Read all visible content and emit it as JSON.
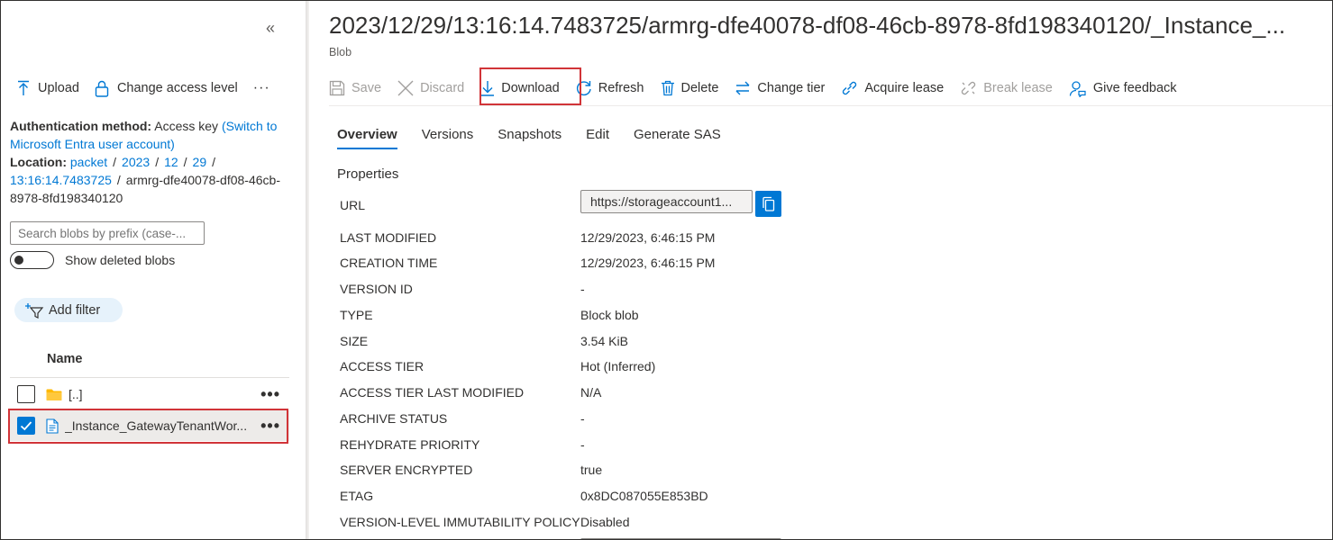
{
  "left_pane": {
    "collapse_glyph": "«",
    "toolbar": {
      "upload_label": "Upload",
      "change_access_label": "Change access level",
      "more_glyph": "···"
    },
    "auth": {
      "method_label": "Authentication method:",
      "method_value": "Access key",
      "switch_link": "(Switch to Microsoft Entra user account)",
      "location_label": "Location:",
      "path_links": [
        "packet",
        "2023",
        "12",
        "29",
        "13:16:14.7483725"
      ],
      "path_tail": "armrg-dfe40078-df08-46cb-8978-8fd198340120"
    },
    "search_placeholder": "Search blobs by prefix (case-...",
    "show_deleted_label": "Show deleted blobs",
    "show_deleted_on": false,
    "add_filter_label": "Add filter",
    "list": {
      "header": "Name",
      "rows": [
        {
          "name": "[..]",
          "checked": false,
          "icon": "folder-icon"
        },
        {
          "name": "_Instance_GatewayTenantWor...",
          "checked": true,
          "icon": "file-icon"
        }
      ]
    }
  },
  "blob": {
    "title": "2023/12/29/13:16:14.7483725/armrg-dfe40078-df08-46cb-8978-8fd198340120/_Instance_...",
    "subtitle": "Blob",
    "toolbar": {
      "save": "Save",
      "discard": "Discard",
      "download": "Download",
      "refresh": "Refresh",
      "delete": "Delete",
      "change_tier": "Change tier",
      "acquire_lease": "Acquire lease",
      "break_lease": "Break lease",
      "give_feedback": "Give feedback"
    },
    "tabs": [
      "Overview",
      "Versions",
      "Snapshots",
      "Edit",
      "Generate SAS"
    ],
    "active_tab": "Overview",
    "properties_title": "Properties",
    "url_label": "URL",
    "url_value": "https://storageaccount1...",
    "properties": [
      {
        "label": "LAST MODIFIED",
        "value": "12/29/2023, 6:46:15 PM"
      },
      {
        "label": "CREATION TIME",
        "value": "12/29/2023, 6:46:15 PM"
      },
      {
        "label": "VERSION ID",
        "value": "-"
      },
      {
        "label": "TYPE",
        "value": "Block blob"
      },
      {
        "label": "SIZE",
        "value": "3.54 KiB"
      },
      {
        "label": "ACCESS TIER",
        "value": "Hot (Inferred)"
      },
      {
        "label": "ACCESS TIER LAST MODIFIED",
        "value": "N/A"
      },
      {
        "label": "ARCHIVE STATUS",
        "value": "-"
      },
      {
        "label": "REHYDRATE PRIORITY",
        "value": "-"
      },
      {
        "label": "SERVER ENCRYPTED",
        "value": "true"
      },
      {
        "label": "ETAG",
        "value": "0x8DC087055E853BD"
      },
      {
        "label": "VERSION-LEVEL IMMUTABILITY POLICY",
        "value": "Disabled"
      }
    ]
  },
  "colors": {
    "accent": "#0078d4",
    "highlight": "#d13438",
    "selected_row": "#edebe9"
  }
}
